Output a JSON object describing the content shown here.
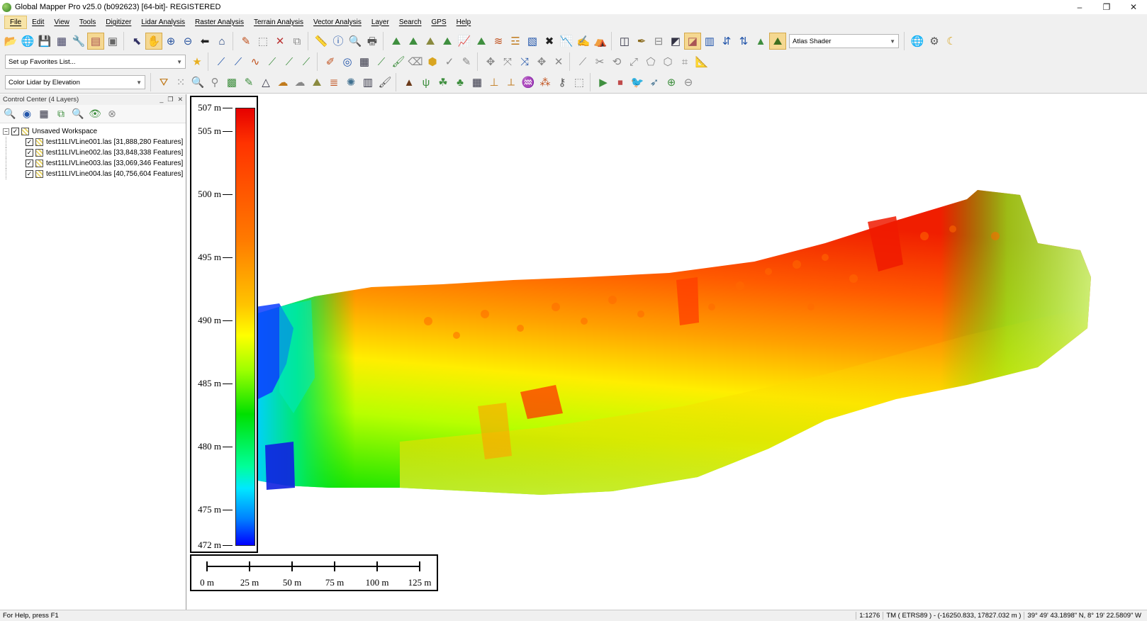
{
  "window": {
    "title": "Global Mapper Pro v25.0 (b092623) [64-bit]- REGISTERED",
    "controls": [
      "–",
      "❐",
      "✕"
    ]
  },
  "menu": [
    "File",
    "Edit",
    "View",
    "Tools",
    "Digitizer",
    "Lidar Analysis",
    "Raster Analysis",
    "Terrain Analysis",
    "Vector Analysis",
    "Layer",
    "Search",
    "GPS",
    "Help"
  ],
  "toolbar": {
    "shader_select": "Atlas Shader",
    "favorites_select": "Set up Favorites List...",
    "lidar_color_select": "Color Lidar by Elevation"
  },
  "control_center": {
    "title": "Control Center (4 Layers)",
    "workspace": "Unsaved Workspace",
    "layers": [
      "test11LIVLine001.las [31,888,280 Features]",
      "test11LIVLine002.las [33,848,338 Features]",
      "test11LIVLine003.las [33,069,346 Features]",
      "test11LIVLine004.las [40,756,604 Features]"
    ]
  },
  "legend": {
    "ticks": [
      "507 m",
      "505 m",
      "500 m",
      "495 m",
      "490 m",
      "485 m",
      "480 m",
      "475 m",
      "472 m"
    ],
    "range_min": 472,
    "range_max": 507
  },
  "scale": {
    "labels": [
      "0 m",
      "25 m",
      "50 m",
      "75 m",
      "100 m",
      "125 m"
    ]
  },
  "status": {
    "help": "For Help, press F1",
    "scale_ratio": "1:1276",
    "projection": "TM ( ETRS89 ) - (-16250.833, 17827.032 m )",
    "geo_coords": "39° 49' 43.1898\" N, 8° 19' 22.5809\" W"
  },
  "colors": {
    "legend_high": "#e60000",
    "legend_mid": "#ffff00",
    "legend_low": "#0000ff",
    "accent": "#f5d891"
  }
}
